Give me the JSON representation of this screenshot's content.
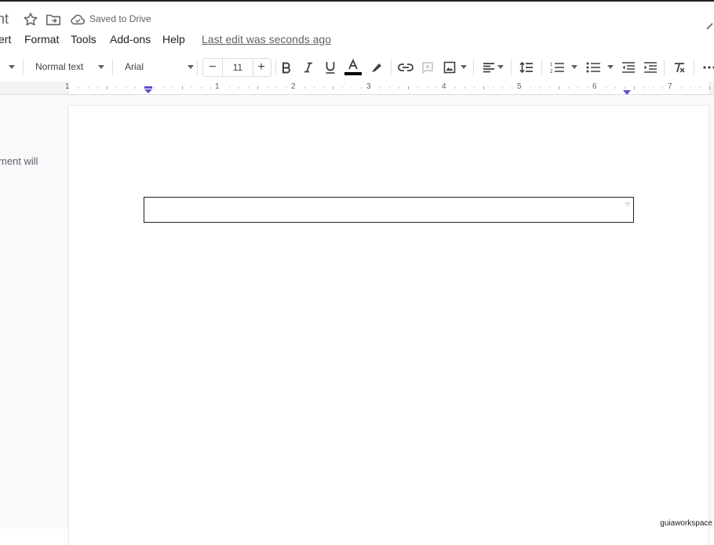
{
  "header": {
    "doc_title_fragment": "nt",
    "saved_status": "Saved to Drive",
    "star_icon": "star-icon",
    "move_icon": "folder-move-icon",
    "cloud_icon": "cloud-done-icon"
  },
  "menu": {
    "items": [
      "ert",
      "Format",
      "Tools",
      "Add-ons",
      "Help"
    ],
    "last_edit": "Last edit was seconds ago"
  },
  "toolbar": {
    "style_value": "Normal text",
    "font_value": "Arial",
    "font_size": "11",
    "minus_label": "−",
    "plus_label": "+",
    "text_color": "#000000"
  },
  "ruler": {
    "numbers": [
      "1",
      "1",
      "2",
      "3",
      "4",
      "5",
      "6",
      "7"
    ]
  },
  "sidebar": {
    "text_fragment": "ment will"
  },
  "watermark": "guiaworkspace",
  "colors": {
    "accent": "#5b4fd1",
    "text": "#3c4043",
    "canvas": "#f8f9fa"
  }
}
